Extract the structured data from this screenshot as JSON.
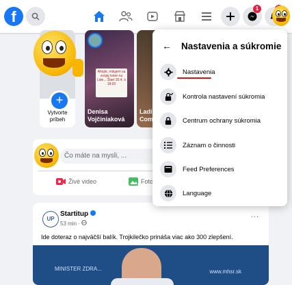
{
  "topbar": {
    "logo_text": "f",
    "messenger_badge": "1",
    "notification_badge": "5"
  },
  "stories": {
    "create_label": "Vytvorte príbeh",
    "story2_name": "Denisa Vojčiniaková",
    "story3_name": "Ladi Com",
    "story2_card_text": "Ahojte, milujem sa svojej tváre na Lide... Štart 30.4. o 18:00"
  },
  "composer": {
    "placeholder": "Čo máte na mysli, ...",
    "live_label": "Živé video",
    "photo_label": "Foto"
  },
  "post": {
    "avatar_text": "UP",
    "author": "Startitup",
    "meta": "53 min · ",
    "more": "...",
    "text": "Ide doteraz o najväčší balík. Trojkilečko prináša viac ako 300 zlepšení.",
    "image_logo1": "MINISTER ZDRA...",
    "image_logo2": "www.mhsr.sk"
  },
  "dropdown": {
    "back_arrow": "←",
    "title": "Nastavenia a súkromie",
    "items": [
      {
        "label": "Nastavenia",
        "icon": "gear-icon"
      },
      {
        "label": "Kontrola nastavení súkromia",
        "icon": "lock-check-icon"
      },
      {
        "label": "Centrum ochrany súkromia",
        "icon": "lock-icon"
      },
      {
        "label": "Záznam o činnosti",
        "icon": "list-icon"
      },
      {
        "label": "Feed Preferences",
        "icon": "feed-icon"
      },
      {
        "label": "Language",
        "icon": "globe-icon"
      }
    ]
  },
  "colors": {
    "brand": "#1877f2",
    "badge": "#e41e3f",
    "annotation": "#dd1111"
  }
}
